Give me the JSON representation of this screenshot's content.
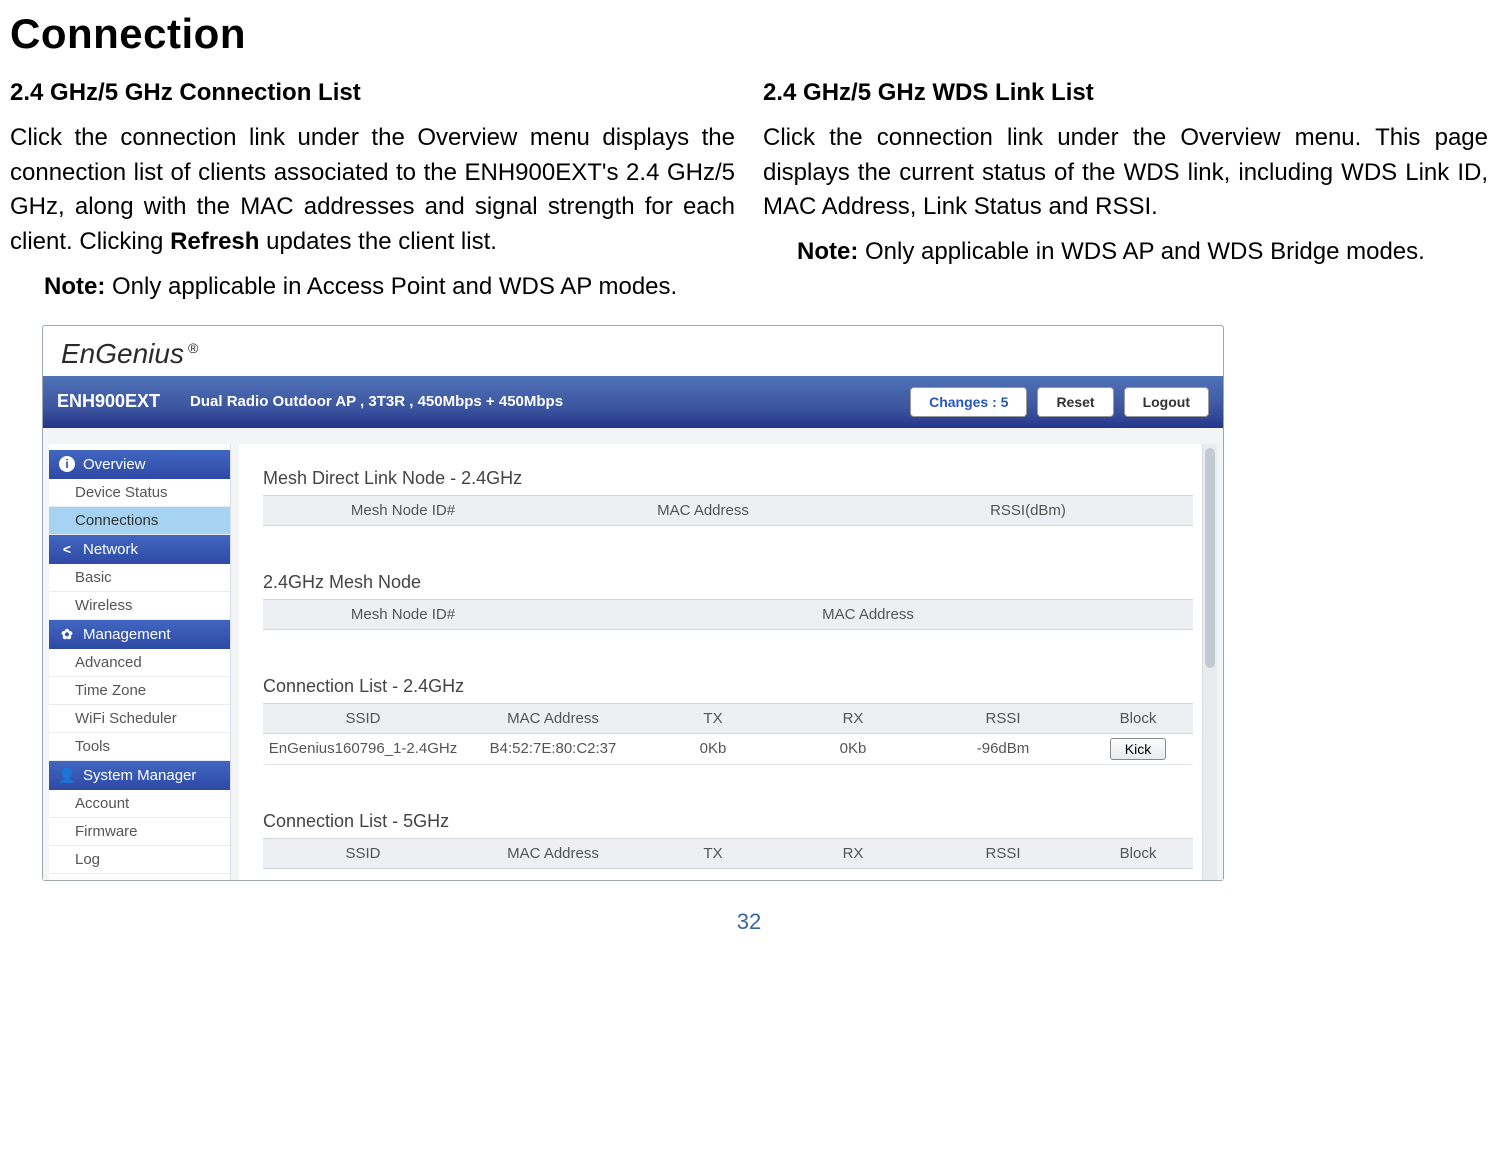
{
  "page": {
    "title": "Connection",
    "number": "32"
  },
  "left_col": {
    "heading": "2.4 GHz/5 GHz Connection List",
    "p1": "Click the connection link under the Overview menu displays the connection list of clients associated to the ENH900EXT's 2.4 GHz/5 GHz, along with the MAC addresses and signal strength for each client. Clicking ",
    "refresh": "Refresh",
    "p1b": " updates the client list.",
    "note_label": "Note:",
    "note": " Only applicable in Access Point and WDS AP modes."
  },
  "right_col": {
    "heading": "2.4 GHz/5 GHz WDS Link List",
    "p1": "Click the connection link under the Overview menu. This page displays the current status of the WDS link, including WDS Link ID, MAC Address, Link Status and RSSI.",
    "note_label": "Note:",
    "note": " Only applicable in WDS AP and WDS Bridge modes."
  },
  "shot": {
    "logo": "EnGenius",
    "model": "ENH900EXT",
    "desc": "Dual Radio Outdoor AP , 3T3R , 450Mbps + 450Mbps",
    "btn_changes": "Changes : 5",
    "btn_reset": "Reset",
    "btn_logout": "Logout",
    "sidebar": {
      "overview": "Overview",
      "items_ov": [
        "Device Status",
        "Connections"
      ],
      "network": "Network",
      "items_net": [
        "Basic",
        "Wireless"
      ],
      "mgmt": "Management",
      "items_mgmt": [
        "Advanced",
        "Time Zone",
        "WiFi Scheduler",
        "Tools"
      ],
      "sys": "System Manager",
      "items_sys": [
        "Account",
        "Firmware",
        "Log"
      ]
    },
    "tables": {
      "t1_title": "Mesh Direct Link Node - 2.4GHz",
      "t1_h": [
        "Mesh Node ID#",
        "MAC Address",
        "RSSI(dBm)"
      ],
      "t2_title": "2.4GHz Mesh Node",
      "t2_h": [
        "Mesh Node ID#",
        "MAC Address"
      ],
      "t3_title": "Connection List - 2.4GHz",
      "t3_h": [
        "SSID",
        "MAC Address",
        "TX",
        "RX",
        "RSSI",
        "Block"
      ],
      "t3_row": {
        "ssid": "EnGenius160796_1-2.4GHz",
        "mac": "B4:52:7E:80:C2:37",
        "tx": "0Kb",
        "rx": "0Kb",
        "rssi": "-96dBm",
        "kick": "Kick"
      },
      "t4_title": "Connection List - 5GHz",
      "t4_h": [
        "SSID",
        "MAC Address",
        "TX",
        "RX",
        "RSSI",
        "Block"
      ]
    }
  }
}
